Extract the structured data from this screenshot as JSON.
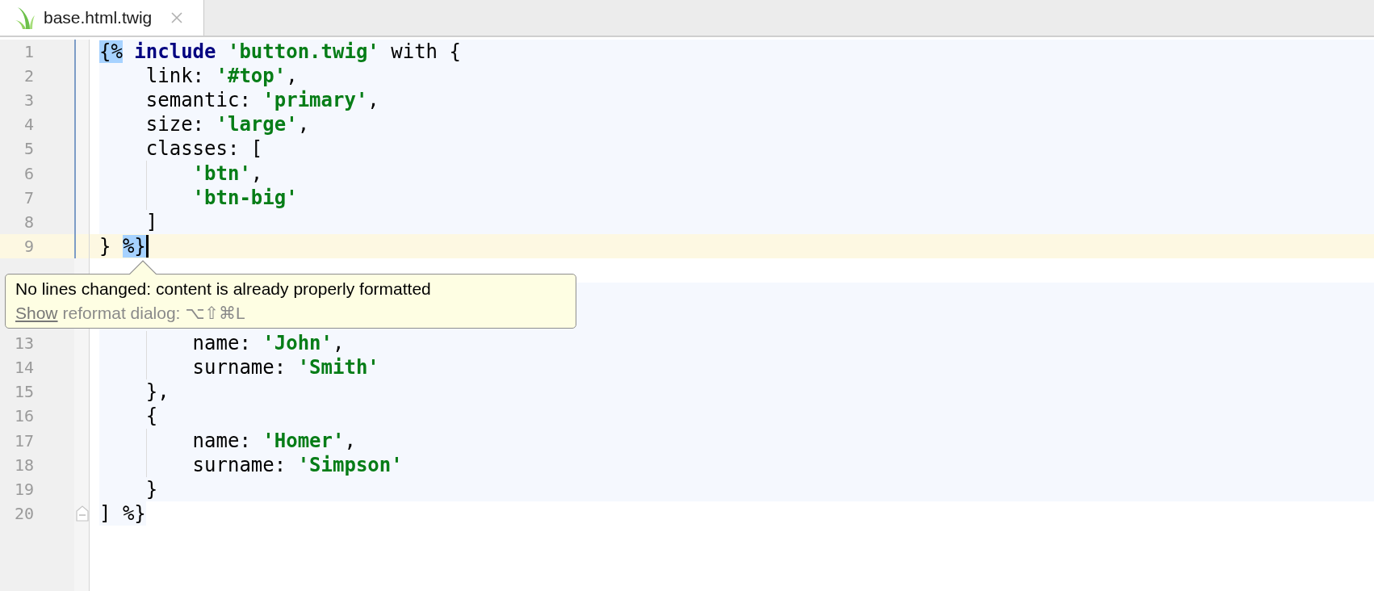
{
  "tabs": [
    {
      "label": "base.html.twig",
      "selected": true
    }
  ],
  "editor": {
    "lines": [
      {
        "number": "1",
        "kind": "block",
        "fold_bar": true,
        "tokens": [
          {
            "kind": "selected",
            "text": "{%"
          },
          {
            "kind": "keyword",
            "text": " include"
          },
          {
            "kind": "string",
            "text": " 'button.twig'"
          },
          {
            "kind": "plain",
            "text": " with {"
          }
        ]
      },
      {
        "number": "2",
        "kind": "block",
        "fold_bar": true,
        "tokens": [
          {
            "kind": "plain",
            "text": "    link: "
          },
          {
            "kind": "string",
            "text": "'#top'"
          },
          {
            "kind": "plain",
            "text": ","
          }
        ]
      },
      {
        "number": "3",
        "kind": "block",
        "fold_bar": true,
        "tokens": [
          {
            "kind": "plain",
            "text": "    semantic: "
          },
          {
            "kind": "string",
            "text": "'primary'"
          },
          {
            "kind": "plain",
            "text": ","
          }
        ]
      },
      {
        "number": "4",
        "kind": "block",
        "fold_bar": true,
        "tokens": [
          {
            "kind": "plain",
            "text": "    size: "
          },
          {
            "kind": "string",
            "text": "'large'"
          },
          {
            "kind": "plain",
            "text": ","
          }
        ]
      },
      {
        "number": "5",
        "kind": "block",
        "fold_bar": true,
        "tokens": [
          {
            "kind": "plain",
            "text": "    classes: ["
          }
        ]
      },
      {
        "number": "6",
        "kind": "block",
        "fold_bar": true,
        "guide": true,
        "tokens": [
          {
            "kind": "string",
            "text": "        'btn'"
          },
          {
            "kind": "plain",
            "text": ","
          }
        ]
      },
      {
        "number": "7",
        "kind": "block",
        "fold_bar": true,
        "guide": true,
        "tokens": [
          {
            "kind": "string",
            "text": "        'btn-big'"
          }
        ]
      },
      {
        "number": "8",
        "kind": "block",
        "fold_bar": true,
        "tokens": [
          {
            "kind": "plain",
            "text": "    ]"
          }
        ]
      },
      {
        "number": "9",
        "kind": "current",
        "fold_bar": true,
        "caret": true,
        "tokens": [
          {
            "kind": "plain",
            "text": "} "
          },
          {
            "kind": "selected",
            "text": "%}"
          }
        ]
      },
      {
        "kind": "plain"
      },
      {
        "number": "13",
        "kind": "block",
        "guide": true,
        "tokens": [
          {
            "kind": "plain",
            "text": "        name: "
          },
          {
            "kind": "string",
            "text": "'John'"
          },
          {
            "kind": "plain",
            "text": ","
          }
        ]
      },
      {
        "number": "14",
        "kind": "block",
        "guide": true,
        "tokens": [
          {
            "kind": "plain",
            "text": "        surname: "
          },
          {
            "kind": "string",
            "text": "'Smith'"
          }
        ]
      },
      {
        "number": "15",
        "kind": "block",
        "tokens": [
          {
            "kind": "plain",
            "text": "    },"
          }
        ]
      },
      {
        "number": "16",
        "kind": "block",
        "tokens": [
          {
            "kind": "plain",
            "text": "    {"
          }
        ]
      },
      {
        "number": "17",
        "kind": "block",
        "guide": true,
        "tokens": [
          {
            "kind": "plain",
            "text": "        name: "
          },
          {
            "kind": "string",
            "text": "'Homer'"
          },
          {
            "kind": "plain",
            "text": ","
          }
        ]
      },
      {
        "number": "18",
        "kind": "block",
        "guide": true,
        "tokens": [
          {
            "kind": "plain",
            "text": "        surname: "
          },
          {
            "kind": "string",
            "text": "'Simpson'"
          }
        ]
      },
      {
        "number": "19",
        "kind": "block",
        "tokens": [
          {
            "kind": "plain",
            "text": "    }"
          }
        ]
      },
      {
        "number": "20",
        "kind": "tail",
        "fold_end": true,
        "tokens": [
          {
            "kind": "plain",
            "text": "] %}"
          }
        ]
      }
    ]
  },
  "tooltip": {
    "message": "No lines changed: content is already properly formatted",
    "link": "Show",
    "hint": "reformat dialog: ⌥⇧⌘L"
  }
}
